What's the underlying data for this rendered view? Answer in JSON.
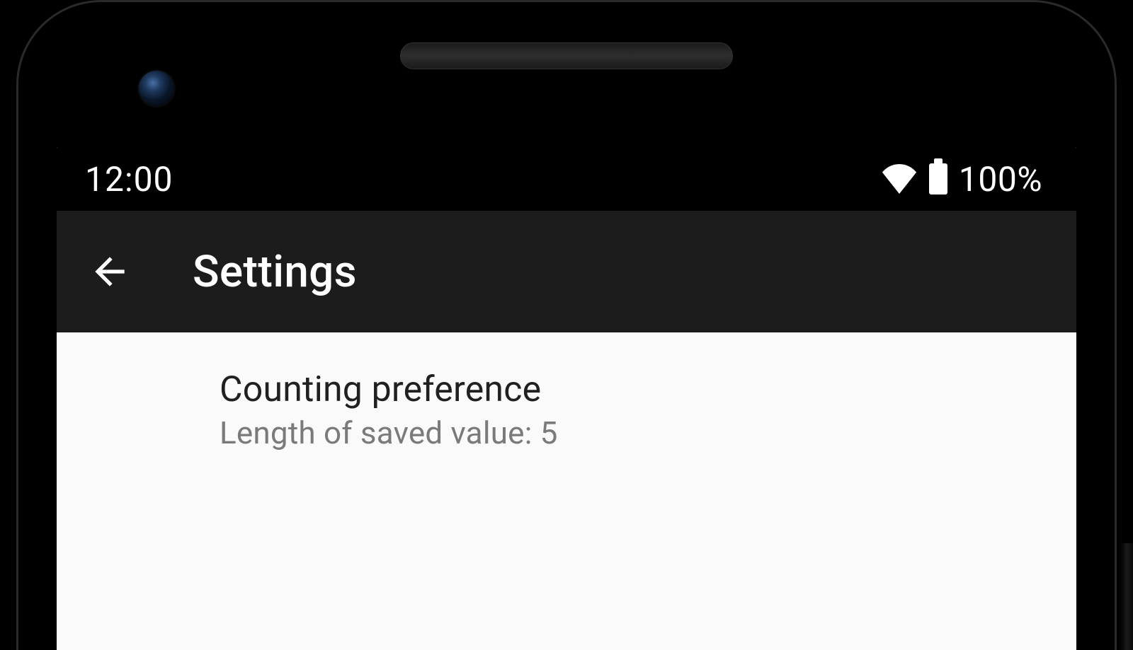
{
  "status_bar": {
    "time": "12:00",
    "battery_percent": "100%"
  },
  "app_bar": {
    "title": "Settings"
  },
  "preferences": {
    "counting": {
      "title": "Counting preference",
      "summary": "Length of saved value: 5"
    }
  }
}
